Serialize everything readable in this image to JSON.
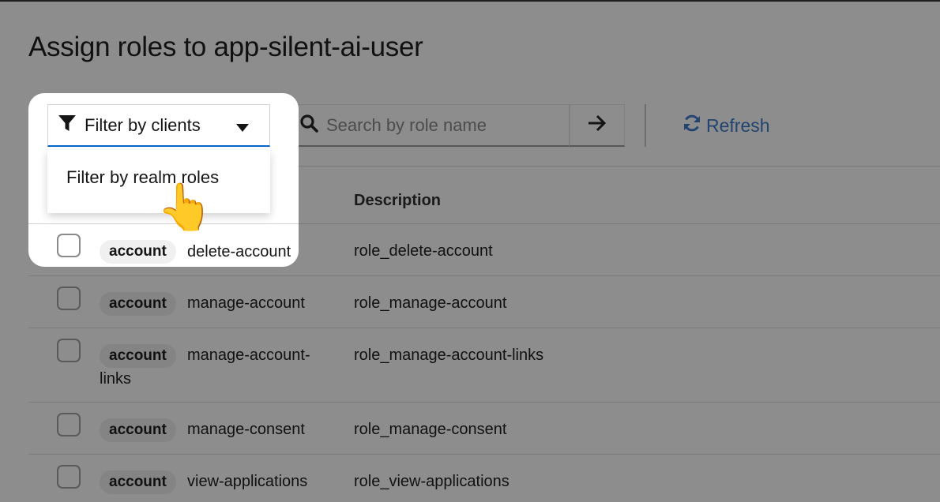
{
  "page": {
    "title": "Assign roles to app-silent-ai-user"
  },
  "toolbar": {
    "filter_label": "Filter by clients",
    "filter_options": [
      "Filter by realm roles"
    ],
    "search_placeholder": "Search by role name",
    "refresh_label": "Refresh"
  },
  "table": {
    "columns": [
      "",
      "Description"
    ],
    "rows": [
      {
        "client": "account",
        "name": "delete-account",
        "description": "role_delete-account"
      },
      {
        "client": "account",
        "name": "manage-account",
        "description": "role_manage-account"
      },
      {
        "client": "account",
        "name": "manage-account-",
        "name_wrap": "links",
        "description": "role_manage-account-links"
      },
      {
        "client": "account",
        "name": "manage-consent",
        "description": "role_manage-consent"
      },
      {
        "client": "account",
        "name": "view-applications",
        "description": "role_view-applications"
      }
    ]
  },
  "cursor": {
    "glyph": "👆"
  },
  "colors": {
    "accent": "#0066cc",
    "link": "#234470",
    "overlay": "#8d8d8d"
  },
  "icons": [
    "filter-icon",
    "caret-down-icon",
    "search-icon",
    "arrow-right-icon",
    "refresh-icon",
    "pointing-hand-icon"
  ]
}
